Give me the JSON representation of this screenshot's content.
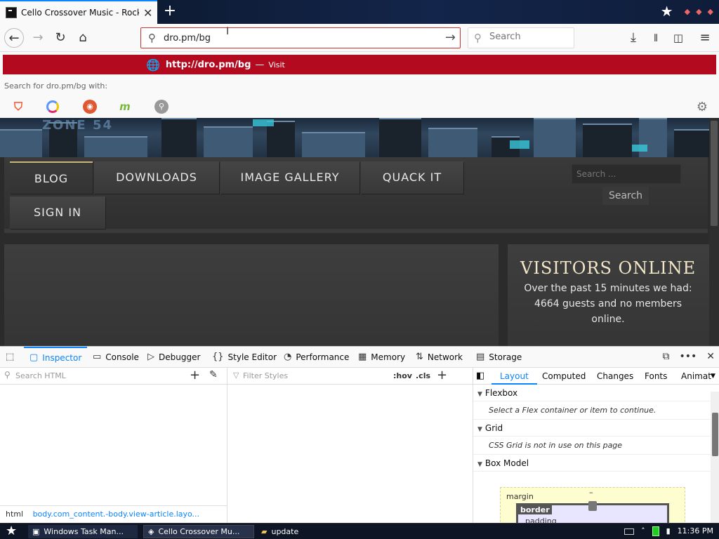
{
  "browser": {
    "tab_title": "Cello Crossover Music - Rock and R",
    "url_value": "dro.pm/bg",
    "search_placeholder": "Search",
    "suggestion": {
      "url": "http://dro.pm/bg",
      "dash": "—",
      "action": "Visit"
    },
    "search_with": "Search for dro.pm/bg with:",
    "engines": [
      {
        "icon": "brave-icon",
        "color": "#fb542b"
      },
      {
        "icon": "qwant-icon",
        "color": "#5c97ff"
      },
      {
        "icon": "duckduckgo-icon",
        "color": "#de5833"
      },
      {
        "icon": "mojeek-icon",
        "color": "#7ab93d"
      },
      {
        "icon": "magnifier-engine-icon",
        "color": "#888888"
      }
    ]
  },
  "site": {
    "logo_text": "ZONE 54",
    "menu": [
      "BLOG",
      "DOWNLOADS",
      "IMAGE GALLERY",
      "QUACK IT",
      "SIGN IN"
    ],
    "search_placeholder": "Search ...",
    "search_button": "Search",
    "sidebar_title": "VISITORS ONLINE",
    "sidebar_text": "Over the past 15 minutes we had: 4664 guests and no members online."
  },
  "devtools": {
    "tabs": [
      {
        "label": "Inspector",
        "icon": "inspector-icon"
      },
      {
        "label": "Console",
        "icon": "console-icon"
      },
      {
        "label": "Debugger",
        "icon": "debugger-icon"
      },
      {
        "label": "Style Editor",
        "icon": "style-editor-icon"
      },
      {
        "label": "Performance",
        "icon": "performance-icon"
      },
      {
        "label": "Memory",
        "icon": "memory-icon"
      },
      {
        "label": "Network",
        "icon": "network-icon"
      },
      {
        "label": "Storage",
        "icon": "storage-icon"
      }
    ],
    "search_html_placeholder": "Search HTML",
    "filter_styles_placeholder": "Filter Styles",
    "hov": ":hov",
    "cls": ".cls",
    "side_tabs": [
      "Layout",
      "Computed",
      "Changes",
      "Fonts",
      "Animat"
    ],
    "flexbox": "Flexbox",
    "flexbox_msg": "Select a Flex container or item to continue.",
    "grid": "Grid",
    "grid_msg": "CSS Grid is not in use on this page",
    "box_model": "Box Model",
    "margin_label": "margin",
    "border_label": "border",
    "padding_label": "padding",
    "dash": "–",
    "breadcrumb_html": "html",
    "breadcrumb_body": "body.com_content.-body.view-article.layo..."
  },
  "taskbar": {
    "task1": "Windows Task Man...",
    "task2": "Cello Crossover Mu...",
    "task3": "update",
    "time": "11:36 PM"
  },
  "colors": {
    "accent": "#0a84ff",
    "suggest_bg": "#b30a1f",
    "sidebar_title": "#f2e6c9"
  }
}
